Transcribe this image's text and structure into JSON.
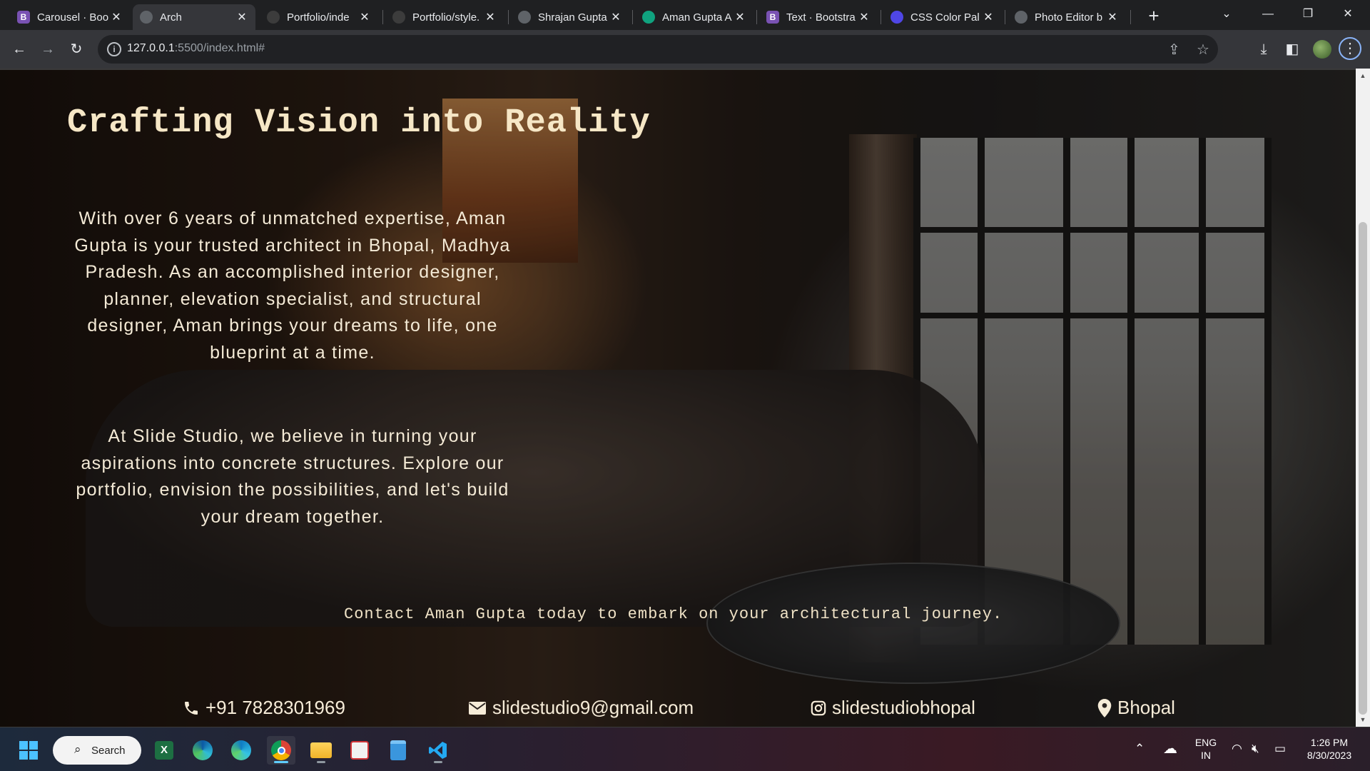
{
  "browser": {
    "tabs": [
      {
        "title": "Carousel · Boo",
        "favicon": "bootstrap-icon",
        "color": "#7952b3"
      },
      {
        "title": "Arch",
        "favicon": "globe-icon",
        "color": "#5f6368",
        "active": true
      },
      {
        "title": "Portfolio/inde",
        "favicon": "github-icon",
        "color": "#3c3c3c"
      },
      {
        "title": "Portfolio/style.",
        "favicon": "github-icon",
        "color": "#3c3c3c"
      },
      {
        "title": "Shrajan Gupta",
        "favicon": "globe-icon",
        "color": "#5f6368"
      },
      {
        "title": "Aman Gupta A",
        "favicon": "chatgpt-icon",
        "color": "#10a37f"
      },
      {
        "title": "Text · Bootstra",
        "favicon": "bootstrap-icon",
        "color": "#7952b3"
      },
      {
        "title": "CSS Color Pal",
        "favicon": "palette-icon",
        "color": "#4f46e5"
      },
      {
        "title": "Photo Editor b",
        "favicon": "globe-icon",
        "color": "#5f6368"
      }
    ],
    "url": {
      "host": "127.0.0.1",
      "rest": ":5500/index.html#"
    }
  },
  "page": {
    "title": "Crafting Vision into Reality",
    "paragraph1": "With over 6 years of unmatched expertise, Aman Gupta is your trusted architect in Bhopal, Madhya Pradesh. As an accomplished interior designer, planner, elevation specialist, and structural designer, Aman brings your dreams to life, one blueprint at a time.",
    "paragraph2": "At Slide Studio, we believe in turning your aspirations into concrete structures. Explore our portfolio, envision the possibilities, and let's build your dream together.",
    "contact_cta": "Contact Aman Gupta today to embark on your architectural journey.",
    "contacts": {
      "phone": "+91 7828301969",
      "email": "slidestudio9@gmail.com",
      "instagram": "slidestudiobhopal",
      "location": "Bhopal"
    }
  },
  "taskbar": {
    "search_label": "Search",
    "lang_top": "ENG",
    "lang_bottom": "IN",
    "time": "1:26 PM",
    "date": "8/30/2023"
  }
}
